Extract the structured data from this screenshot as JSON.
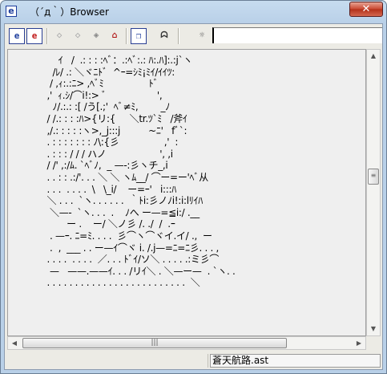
{
  "window": {
    "title": "（´д｀）Browser",
    "close_label": "✕"
  },
  "app_icon_glyph": "e",
  "toolbar": {
    "buttons": [
      {
        "name": "ie-blue-button",
        "glyph": "e",
        "color": "#1c3c9c"
      },
      {
        "name": "ie-red-button",
        "glyph": "e",
        "color": "#c01818"
      },
      {
        "name": "back-button",
        "glyph": "◇",
        "color": "#aaaaaa"
      },
      {
        "name": "forward-button",
        "glyph": "◇",
        "color": "#aaaaaa"
      },
      {
        "name": "up-button",
        "glyph": "◈",
        "color": "#888888"
      },
      {
        "name": "home-button",
        "glyph": "⌂",
        "color": "#b01010"
      },
      {
        "name": "windows-button",
        "glyph": "❐",
        "color": "#1c3c9c"
      },
      {
        "name": "face-button",
        "glyph": "ᗣ",
        "color": "#333333"
      },
      {
        "name": "gear-face-button",
        "glyph": "☼",
        "color": "#555555"
      }
    ],
    "url_value": ""
  },
  "content": {
    "ascii_art": "     ｲ   /  .: : : :ﾍﾞ：.:ﾍﾞ:.: ﾊ:.ﾊ]:.:j`ヽ\n   /ﾚ/ .: ＼ヾﾆﾄﾞ  ^ｰ=ｼﾐ¡ﾐｲ/ｲｲﾂ:\n  / ,ｨ:.:ﾆ> ,ﾍﾞﾐ                ﾄﾞ\n ,'  ｨ.ｼ/⌒i!:> ﾞ                  ',\n   ﾉ/.:.: :[ /う[.;'  ﾍﾞ≠ﾐ,        _ﾉ\n / /.: : : :ﾊ>{リ:{     ＼tr.ﾂ`ﾐ   /斧ｲ\n ,/.: : : : :ヽ>,_j:::j          ~ﾆ'   fﾞ`:\n . : : : : : : : ﾉ\\:{彡                ,'  :\n . : : : / / / ハノ                   ', ,i\n / /' ,:/ﾑ. `ﾍﾞﾉ,  _ —‐:彡ヽチ_,i\n . . : : .:/'. . . ＼ ＼ ヽﾑ__/ ⌒ー=ー'ﾍﾞ从\n . . .  . . . .  \\   \\_i/    ー=ｰ'   i:::ﾊ\n ＼ . . .  `ヽ. . . . . .  ｀ﾄi:彡ノﾉi!:i:lﾘｲﾊ\n  ＼—-  `ヽ. . .  .    ﾉへ ー—=≦i:/ .__\n        ー .    ー/ ＼ノ彡 /. ./  /  .ｰ\n  . —ｰ. ﾆ=ﾐ. . . .  彡⌒ヽ⌒ヾイ.イ/ .,  ー\n  .  ,  ___ . . ー—ｲ⌒ヾ i. /.j—=ﾆ=ﾆ彡. . . ,\n . . . .  . . . .  ／. . . ﾄﾞｲ/ソ＼ . . . . .:ミ彡⌒\n  —   ——.——ｲ. . . /リｲ＼ . ＼—ー—  . `ヽ. .\n . . . . . . . . . . . . . . . . . . . . . . . . .  ＼"
  },
  "vscroll": {
    "up_glyph": "▲",
    "down_glyph": "▼",
    "thumb_glyph": "≡"
  },
  "hscroll": {
    "left_glyph": "◀",
    "right_glyph": "▶",
    "thumb_glyph": "|||"
  },
  "status": {
    "filename": "蒼天航路.ast"
  }
}
